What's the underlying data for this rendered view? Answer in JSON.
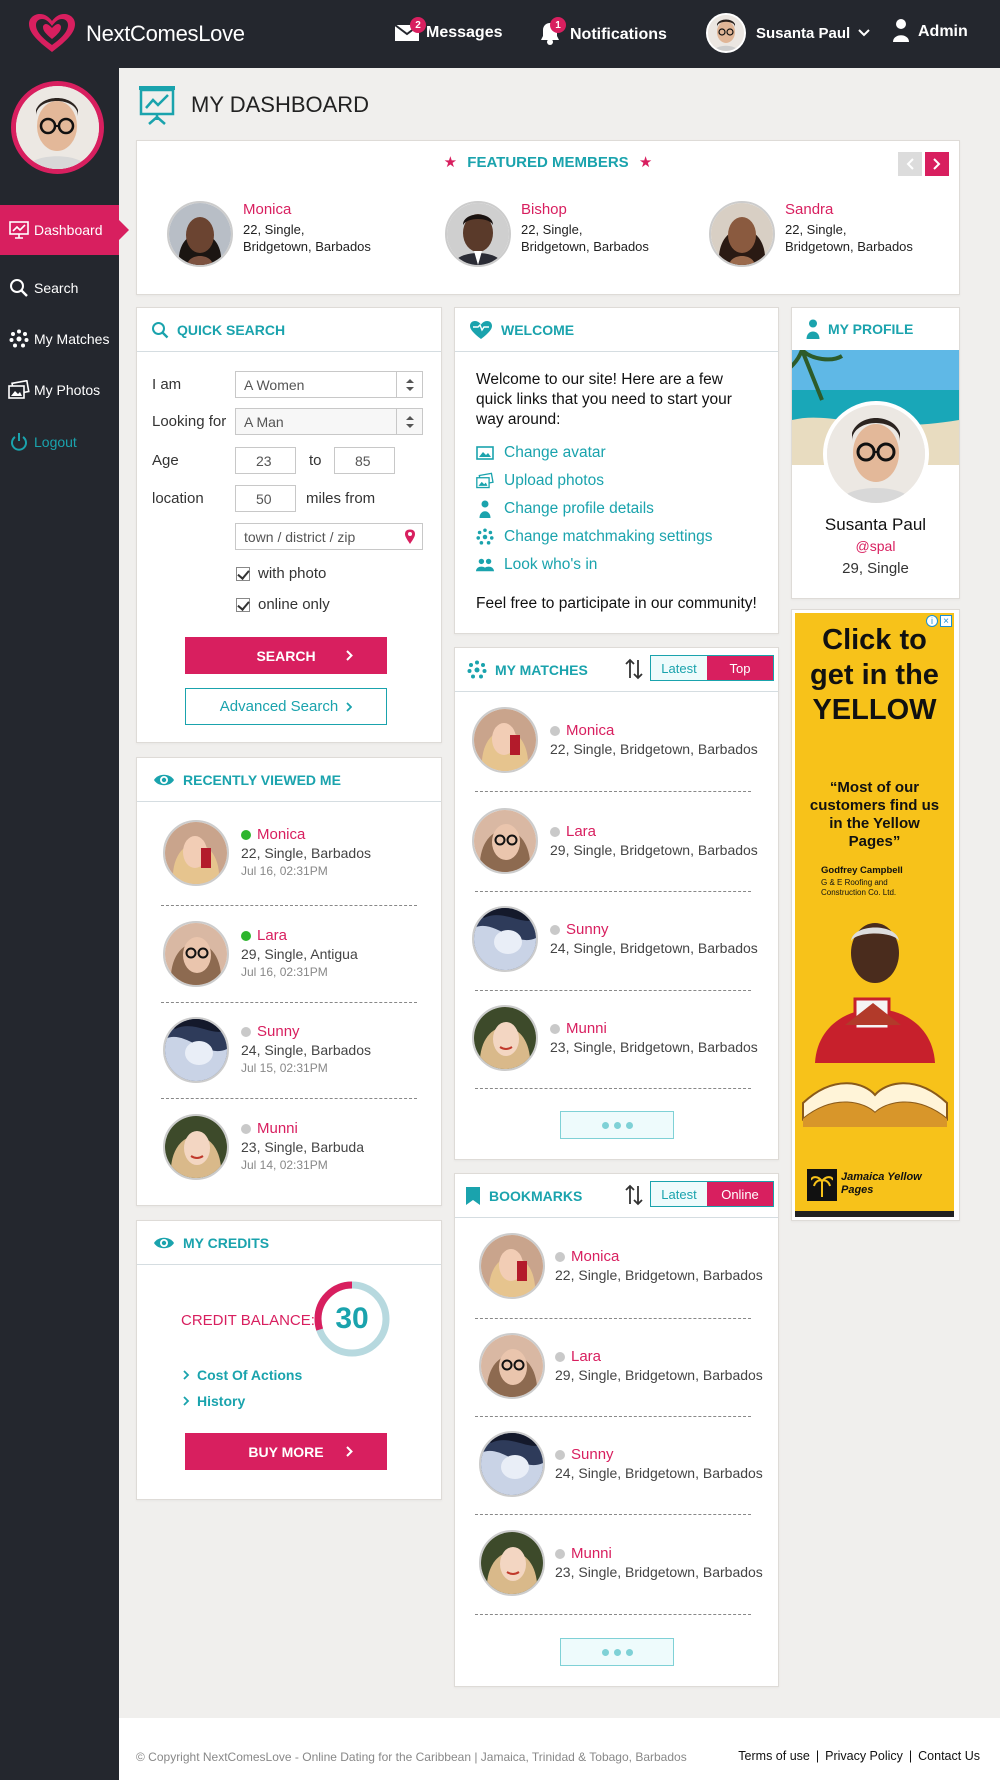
{
  "app": {
    "name": "NextComesLove"
  },
  "header": {
    "messages": {
      "label": "Messages",
      "count": "2"
    },
    "notifications": {
      "label": "Notifications",
      "count": "1"
    },
    "user_name": "Susanta Paul",
    "admin_label": "Admin"
  },
  "sidebar": {
    "items": [
      {
        "label": "Dashboard",
        "icon": "chart-icon",
        "active": true
      },
      {
        "label": "Search",
        "icon": "search-icon"
      },
      {
        "label": "My Matches",
        "icon": "matches-icon"
      },
      {
        "label": "My Photos",
        "icon": "photos-icon"
      },
      {
        "label": "Logout",
        "icon": "power-icon"
      }
    ]
  },
  "page": {
    "title": "MY DASHBOARD"
  },
  "featured": {
    "title": "FEATURED MEMBERS",
    "members": [
      {
        "name": "Monica",
        "line1": "22, Single,",
        "line2": "Bridgetown, Barbados"
      },
      {
        "name": "Bishop",
        "line1": "22, Single,",
        "line2": "Bridgetown, Barbados"
      },
      {
        "name": "Sandra",
        "line1": "22, Single,",
        "line2": "Bridgetown, Barbados"
      }
    ]
  },
  "quick_search": {
    "title": "QUICK SEARCH",
    "i_am_label": "I am",
    "i_am_value": "A Women",
    "looking_label": "Looking for",
    "looking_value": "A Man",
    "age_label": "Age",
    "age_from": "23",
    "age_to_label": "to",
    "age_to": "85",
    "location_label": "location",
    "miles": "50",
    "miles_label": "miles from",
    "zip_placeholder": "town / district / zip",
    "with_photo": "with photo",
    "online_only": "online only",
    "search_button": "SEARCH",
    "advanced_button": "Advanced Search"
  },
  "recently_viewed": {
    "title": "RECENTLY VIEWED ME",
    "members": [
      {
        "name": "Monica",
        "details": "22, Single, Barbados",
        "date": "Jul 16, 02:31PM",
        "online": true
      },
      {
        "name": "Lara",
        "details": "29, Single, Antigua",
        "date": "Jul 16, 02:31PM",
        "online": true
      },
      {
        "name": "Sunny",
        "details": "24, Single, Barbados",
        "date": "Jul 15, 02:31PM",
        "online": false
      },
      {
        "name": "Munni",
        "details": "23, Single, Barbuda",
        "date": "Jul 14, 02:31PM",
        "online": false
      }
    ]
  },
  "credits": {
    "title": "MY CREDITS",
    "balance_label": "CREDIT BALANCE:",
    "balance": "30",
    "balance_fraction": 0.3,
    "link1": "Cost Of Actions",
    "link2": "History",
    "buy_button": "BUY MORE"
  },
  "welcome": {
    "title": "WELCOME",
    "intro": "Welcome to our site! Here are a few quick links that you need to start your way around:",
    "links": [
      {
        "label": "Change avatar",
        "icon": "image-icon"
      },
      {
        "label": "Upload photos",
        "icon": "photos-icon"
      },
      {
        "label": "Change profile details",
        "icon": "person-icon"
      },
      {
        "label": "Change matchmaking settings",
        "icon": "matches-icon"
      },
      {
        "label": "Look who's in",
        "icon": "people-icon"
      }
    ],
    "outro": "Feel free to participate in our community!"
  },
  "my_matches": {
    "title": "MY MATCHES",
    "tab1": "Latest",
    "tab2": "Top",
    "members": [
      {
        "name": "Monica",
        "details": "22, Single, Bridgetown, Barbados"
      },
      {
        "name": "Lara",
        "details": "29, Single, Bridgetown, Barbados"
      },
      {
        "name": "Sunny",
        "details": "24, Single, Bridgetown, Barbados"
      },
      {
        "name": "Munni",
        "details": "23, Single, Bridgetown, Barbados"
      }
    ]
  },
  "bookmarks": {
    "title": "BOOKMARKS",
    "tab1": "Latest",
    "tab2": "Online",
    "members": [
      {
        "name": "Monica",
        "details": "22, Single, Bridgetown, Barbados"
      },
      {
        "name": "Lara",
        "details": "29, Single, Bridgetown, Barbados"
      },
      {
        "name": "Sunny",
        "details": "24, Single, Bridgetown, Barbados"
      },
      {
        "name": "Munni",
        "details": "23, Single, Bridgetown, Barbados"
      }
    ]
  },
  "profile": {
    "title": "MY PROFILE",
    "name": "Susanta Paul",
    "handle": "@spal",
    "details": "29, Single"
  },
  "ad": {
    "headline": "Click to get in the YELLOW",
    "quote": "“Most of our customers find us in the Yellow Pages”",
    "person": "Godfrey Campbell",
    "company": "G & E Roofing and Construction Co. Ltd.",
    "brand": "Jamaica Yellow Pages"
  },
  "footer": {
    "copyright": "© Copyright NextComesLove - Online Dating for the Caribbean | Jamaica, Trinidad & Tobago, Barbados",
    "terms": "Terms of use",
    "privacy": "Privacy Policy",
    "contact": "Contact Us"
  },
  "colors": {
    "accent": "#d81f5f",
    "teal": "#1aa3ad",
    "dark": "#24272e",
    "online": "#2db52d",
    "offline": "#c9c9c9"
  }
}
